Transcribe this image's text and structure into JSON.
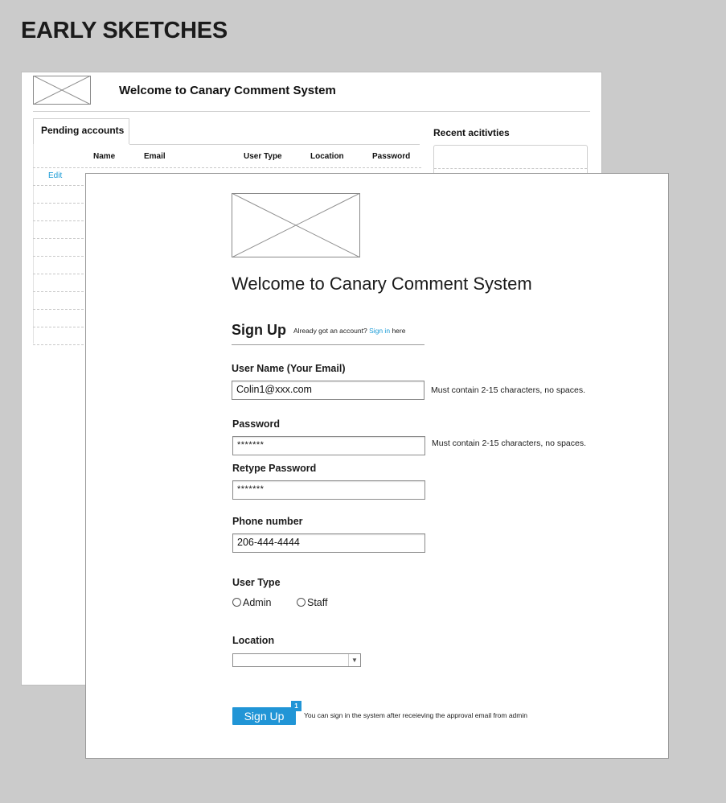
{
  "heading": "EARLY SKETCHES",
  "back_sketch": {
    "title": "Welcome to Canary Comment System",
    "tab_label": "Pending accounts",
    "columns": [
      "Name",
      "Email",
      "User Type",
      "Location",
      "Password"
    ],
    "first_row_action": "Edit",
    "recent_label": "Recent acitivties"
  },
  "front_sketch": {
    "title": "Welcome to Canary Comment System",
    "signup_title": "Sign Up",
    "already_text": "Already got an account?",
    "sign_in_link": "Sign in",
    "already_suffix": "here",
    "username_label": "User Name (Your Email)",
    "username_value": "Colin1@xxx.com",
    "username_hint": "Must contain 2-15 characters, no spaces.",
    "password_label": "Password",
    "password_value": "*******",
    "password_hint": "Must contain 2-15 characters, no spaces.",
    "retype_label": "Retype Password",
    "retype_value": "*******",
    "phone_label": "Phone number",
    "phone_value": "206-444-4444",
    "usertype_label": "User Type",
    "usertype_options": [
      "Admin",
      "Staff"
    ],
    "location_label": "Location",
    "location_value": "",
    "signup_button": "Sign Up",
    "badge": "1",
    "note": "You can sign in the system after receieving the approval email from admin"
  }
}
